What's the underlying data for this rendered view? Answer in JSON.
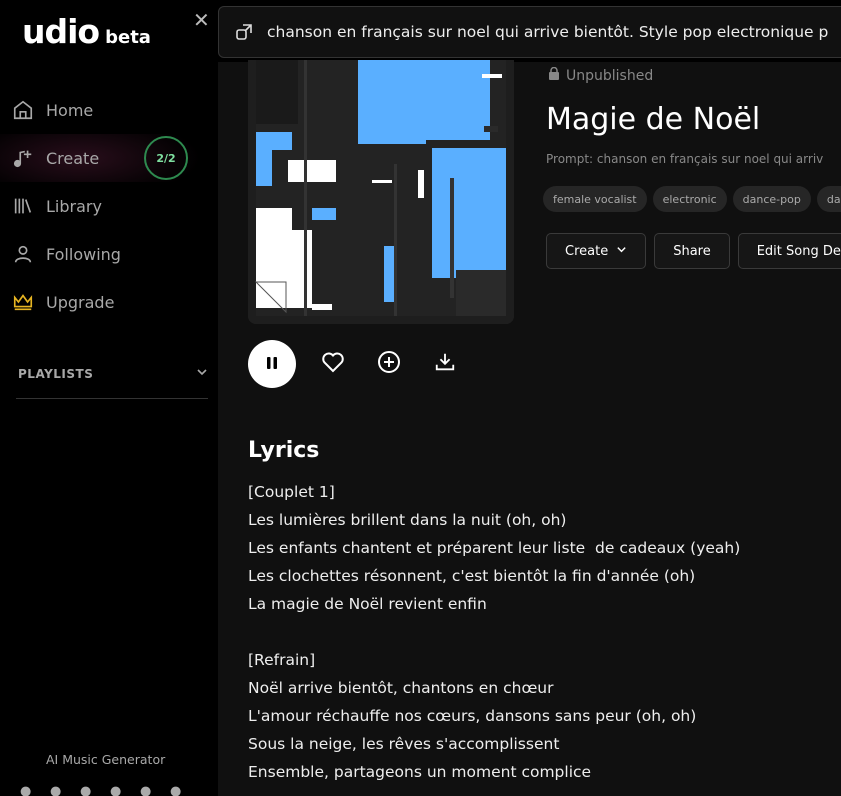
{
  "sidebar": {
    "logo_main": "udio",
    "logo_beta": "beta",
    "nav": [
      {
        "label": "Home",
        "icon": "home-icon"
      },
      {
        "label": "Create",
        "icon": "music-plus-icon",
        "badge": "2/2"
      },
      {
        "label": "Library",
        "icon": "library-icon"
      },
      {
        "label": "Following",
        "icon": "user-icon"
      },
      {
        "label": "Upgrade",
        "icon": "crown-icon"
      }
    ],
    "playlists_label": "PLAYLISTS",
    "footer_text": "AI Music Generator",
    "socials": [
      "twitter-icon",
      "instagram-icon",
      "discord-icon",
      "tiktok-icon",
      "reddit-icon",
      "youtube-icon"
    ]
  },
  "topbar": {
    "prompt_text": "chanson en français sur noel qui arrive bientôt. Style pop electronique p"
  },
  "song": {
    "status": "Unpublished",
    "title": "Magie de Noël",
    "prompt": "Prompt: chanson en français sur noel qui arriv",
    "tags": [
      "female vocalist",
      "electronic",
      "dance-pop",
      "dan"
    ],
    "actions": {
      "create": "Create",
      "share": "Share",
      "edit": "Edit Song De"
    }
  },
  "lyrics": {
    "heading": "Lyrics",
    "text": "[Couplet 1]\nLes lumières brillent dans la nuit (oh, oh)\nLes enfants chantent et préparent leur liste  de cadeaux (yeah)\nLes clochettes résonnent, c'est bientôt la fin d'année (oh)\nLa magie de Noël revient enfin\n\n[Refrain]\nNoël arrive bientôt, chantons en chœur\nL'amour réchauffe nos cœurs, dansons sans peur (oh, oh)\nSous la neige, les rêves s'accomplissent\nEnsemble, partageons un moment complice"
  },
  "colors": {
    "accent_blue": "#5aafff",
    "badge_green": "#2e8a4f",
    "crown": "#e6b422"
  }
}
